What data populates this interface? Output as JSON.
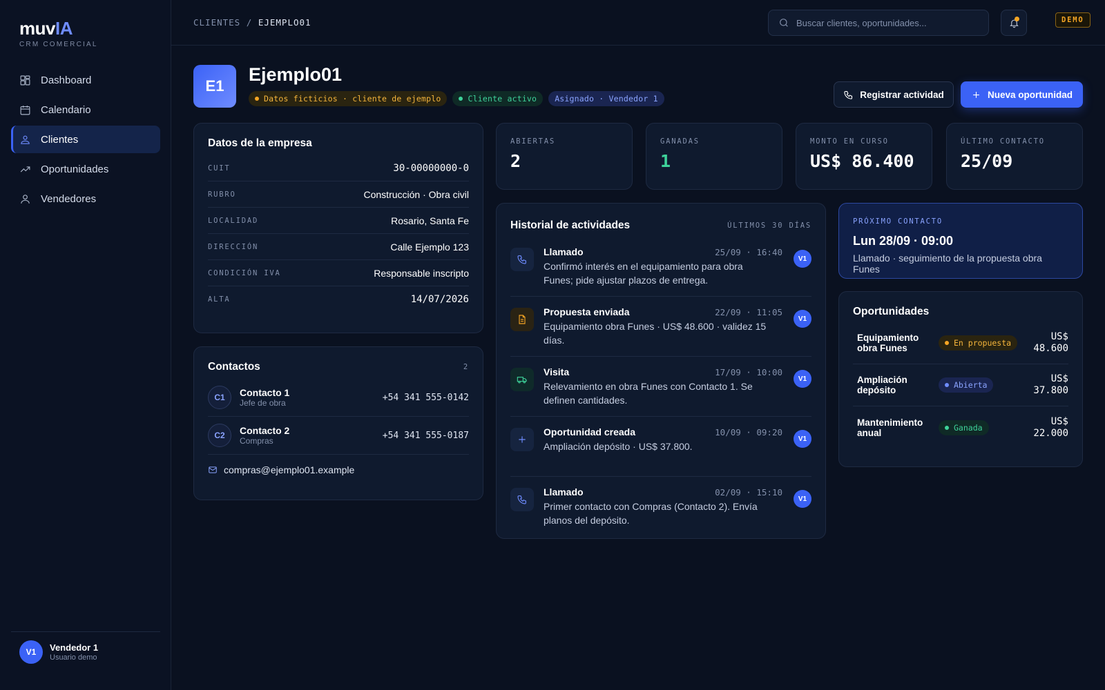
{
  "app": {
    "logo_main": "muv",
    "logo_accent": "IA",
    "subtitle": "CRM COMERCIAL"
  },
  "sidebar": {
    "items": [
      {
        "label": "Dashboard",
        "icon": "dashboard-icon"
      },
      {
        "label": "Calendario",
        "icon": "calendar-icon"
      },
      {
        "label": "Clientes",
        "icon": "clients-icon",
        "active": true
      },
      {
        "label": "Oportunidades",
        "icon": "trending-up-icon"
      },
      {
        "label": "Vendedores",
        "icon": "user-icon"
      }
    ],
    "user": {
      "initials": "V1",
      "name": "Vendedor 1",
      "role": "Usuario demo"
    }
  },
  "topbar": {
    "breadcrumb_root": "CLIENTES",
    "breadcrumb_sep": "/",
    "breadcrumb_current": "EJEMPLO01",
    "search_placeholder": "Buscar clientes, oportunidades...",
    "badge": "DEMO"
  },
  "client": {
    "initials": "E1",
    "name": "Ejemplo01",
    "pills": {
      "fake": "Datos ficticios · cliente de ejemplo",
      "status": "Cliente activo",
      "assigned": "Asignado · Vendedor 1"
    },
    "actions": {
      "register": "Registrar actividad",
      "new_opportunity": "Nueva oportunidad"
    }
  },
  "empresa": {
    "title": "Datos de la empresa",
    "rows": [
      {
        "label": "CUIT",
        "value": "30-00000000-0"
      },
      {
        "label": "RUBRO",
        "value": "Construcción · Obra civil"
      },
      {
        "label": "LOCALIDAD",
        "value": "Rosario, Santa Fe"
      },
      {
        "label": "DIRECCIÓN",
        "value": "Calle Ejemplo 123"
      },
      {
        "label": "CONDICIÓN IVA",
        "value": "Responsable inscripto"
      },
      {
        "label": "ALTA",
        "value": "14/07/2026"
      }
    ]
  },
  "contactos": {
    "title": "Contactos",
    "count": "2",
    "items": [
      {
        "initials": "C1",
        "name": "Contacto 1",
        "role": "Jefe de obra",
        "phone": "+54 341 555-0142"
      },
      {
        "initials": "C2",
        "name": "Contacto 2",
        "role": "Compras",
        "phone": "+54 341 555-0187"
      }
    ],
    "email": "compras@ejemplo01.example"
  },
  "stats": [
    {
      "label": "ABIERTAS",
      "value": "2"
    },
    {
      "label": "GANADAS",
      "value": "1"
    },
    {
      "label": "MONTO EN CURSO",
      "value": "US$ 86.400"
    },
    {
      "label": "ÚLTIMO CONTACTO",
      "value": "25/09"
    }
  ],
  "historial": {
    "title": "Historial de actividades",
    "range": "ÚLTIMOS 30 DÍAS",
    "items": [
      {
        "icon": "phone-icon",
        "title": "Llamado",
        "time": "25/09 · 16:40",
        "desc": "Confirmó interés en el equipamiento para obra Funes; pide ajustar plazos de entrega.",
        "user": "V1"
      },
      {
        "icon": "document-icon",
        "title": "Propuesta enviada",
        "time": "22/09 · 11:05",
        "desc": "Equipamiento obra Funes · US$ 48.600 · validez 15 días.",
        "user": "V1"
      },
      {
        "icon": "truck-icon",
        "title": "Visita",
        "time": "17/09 · 10:00",
        "desc": "Relevamiento en obra Funes con Contacto 1. Se definen cantidades.",
        "user": "V1"
      },
      {
        "icon": "plus-icon",
        "title": "Oportunidad creada",
        "time": "10/09 · 09:20",
        "desc": "Ampliación depósito · US$ 37.800.",
        "user": "V1"
      },
      {
        "icon": "phone-icon",
        "title": "Llamado",
        "time": "02/09 · 15:10",
        "desc": "Primer contacto con Compras (Contacto 2). Envía planos del depósito.",
        "user": "V1"
      }
    ]
  },
  "proximo": {
    "label": "PRÓXIMO CONTACTO",
    "when": "Lun 28/09 · 09:00",
    "desc": "Llamado · seguimiento de la propuesta obra Funes"
  },
  "oportunidades": {
    "title": "Oportunidades",
    "items": [
      {
        "name": "Equipamiento obra Funes",
        "status": "En propuesta",
        "amount_currency": "US$",
        "amount": "48.600"
      },
      {
        "name": "Ampliación depósito",
        "status": "Abierta",
        "amount_currency": "US$",
        "amount": "37.800"
      },
      {
        "name": "Mantenimiento anual",
        "status": "Ganada",
        "amount_currency": "US$",
        "amount": "22.000"
      }
    ]
  },
  "colors": {
    "accent": "#3b62f6",
    "background": "#0a1120",
    "card": "#0f1a2e",
    "success": "#3ed29a",
    "warning": "#f5a524"
  }
}
